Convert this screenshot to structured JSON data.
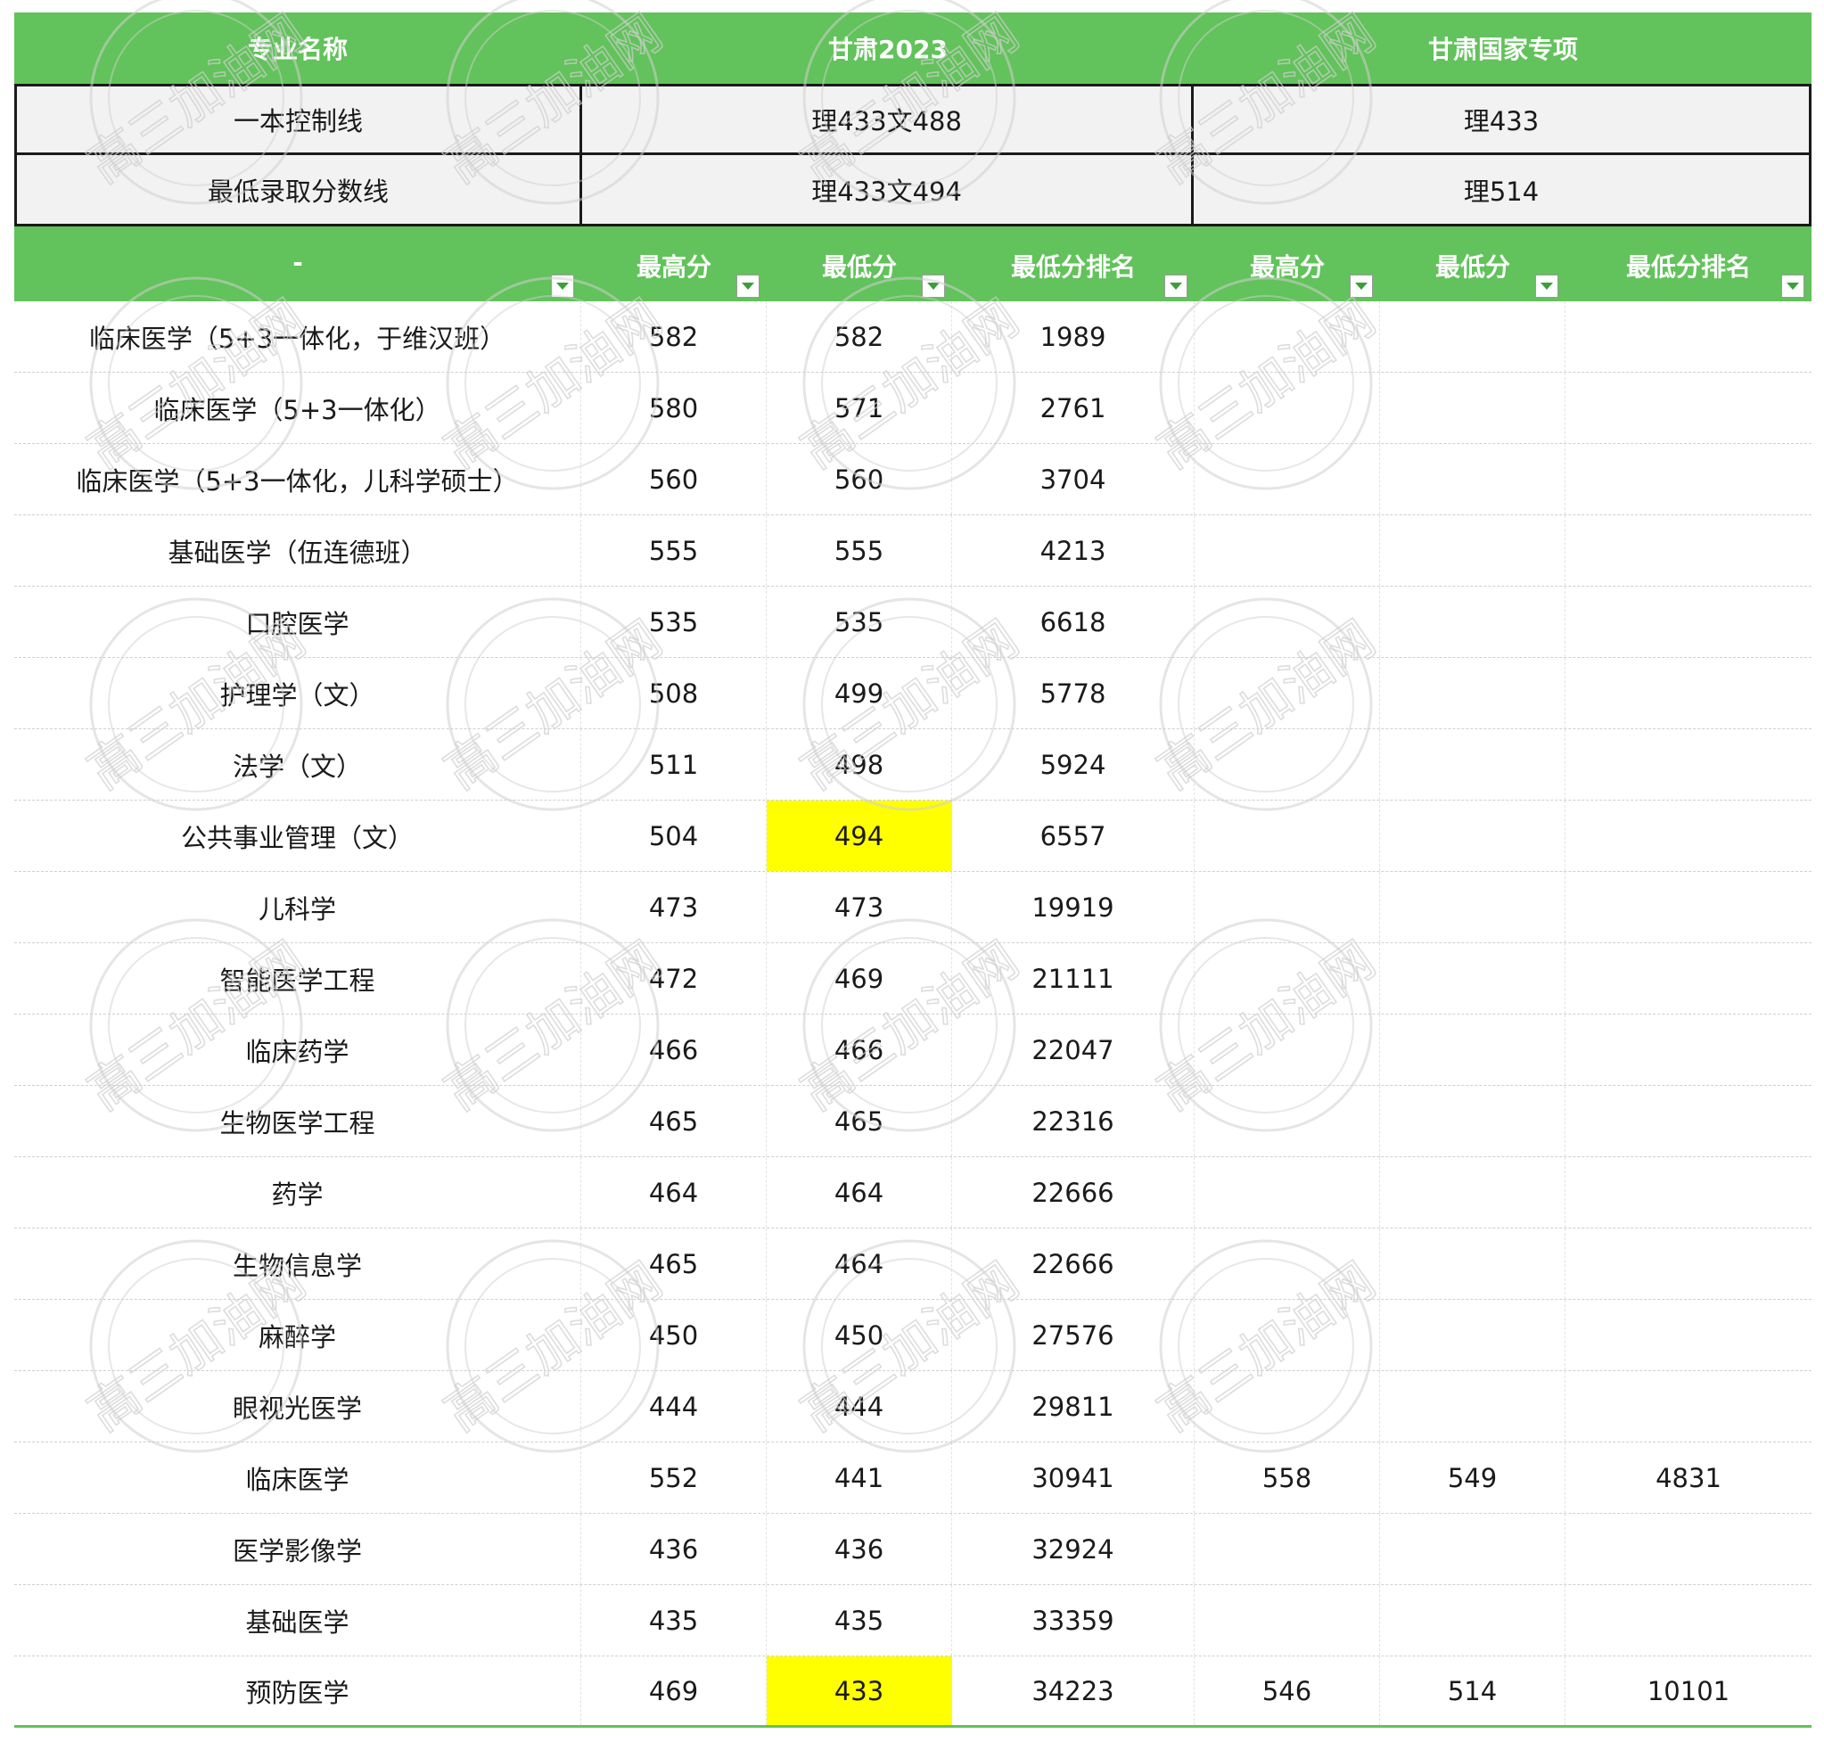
{
  "header": {
    "major": "专业名称",
    "group1": "甘肃2023",
    "group2": "甘肃国家专项"
  },
  "control_line": {
    "label": "一本控制线",
    "g1": "理433文488",
    "g2": "理433"
  },
  "min_score": {
    "label": "最低录取分数线",
    "g1": "理433文494",
    "g2": "理514"
  },
  "subheader": [
    "-",
    "最高分",
    "最低分",
    "最低分排名",
    "最高分",
    "最低分",
    "最低分排名"
  ],
  "rows": [
    [
      "临床医学（5+3一体化，于维汉班）",
      "582",
      "582",
      "1989",
      "",
      "",
      ""
    ],
    [
      "临床医学（5+3一体化）",
      "580",
      "571",
      "2761",
      "",
      "",
      ""
    ],
    [
      "临床医学（5+3一体化，儿科学硕士）",
      "560",
      "560",
      "3704",
      "",
      "",
      ""
    ],
    [
      "基础医学（伍连德班）",
      "555",
      "555",
      "4213",
      "",
      "",
      ""
    ],
    [
      "口腔医学",
      "535",
      "535",
      "6618",
      "",
      "",
      ""
    ],
    [
      "护理学（文）",
      "508",
      "499",
      "5778",
      "",
      "",
      ""
    ],
    [
      "法学（文）",
      "511",
      "498",
      "5924",
      "",
      "",
      ""
    ],
    [
      "公共事业管理（文）",
      "504",
      "494",
      "6557",
      "",
      "",
      ""
    ],
    [
      "儿科学",
      "473",
      "473",
      "19919",
      "",
      "",
      ""
    ],
    [
      "智能医学工程",
      "472",
      "469",
      "21111",
      "",
      "",
      ""
    ],
    [
      "临床药学",
      "466",
      "466",
      "22047",
      "",
      "",
      ""
    ],
    [
      "生物医学工程",
      "465",
      "465",
      "22316",
      "",
      "",
      ""
    ],
    [
      "药学",
      "464",
      "464",
      "22666",
      "",
      "",
      ""
    ],
    [
      "生物信息学",
      "465",
      "464",
      "22666",
      "",
      "",
      ""
    ],
    [
      "麻醉学",
      "450",
      "450",
      "27576",
      "",
      "",
      ""
    ],
    [
      "眼视光医学",
      "444",
      "444",
      "29811",
      "",
      "",
      ""
    ],
    [
      "临床医学",
      "552",
      "441",
      "30941",
      "558",
      "549",
      "4831"
    ],
    [
      "医学影像学",
      "436",
      "436",
      "32924",
      "",
      "",
      ""
    ],
    [
      "基础医学",
      "435",
      "435",
      "33359",
      "",
      "",
      ""
    ],
    [
      "预防医学",
      "469",
      "433",
      "34223",
      "546",
      "514",
      "10101"
    ]
  ],
  "highlight_rows": [
    7,
    19
  ],
  "highlight_color": "#ffff00",
  "header_color": "#62c25b",
  "watermark_text": "高三加油网"
}
